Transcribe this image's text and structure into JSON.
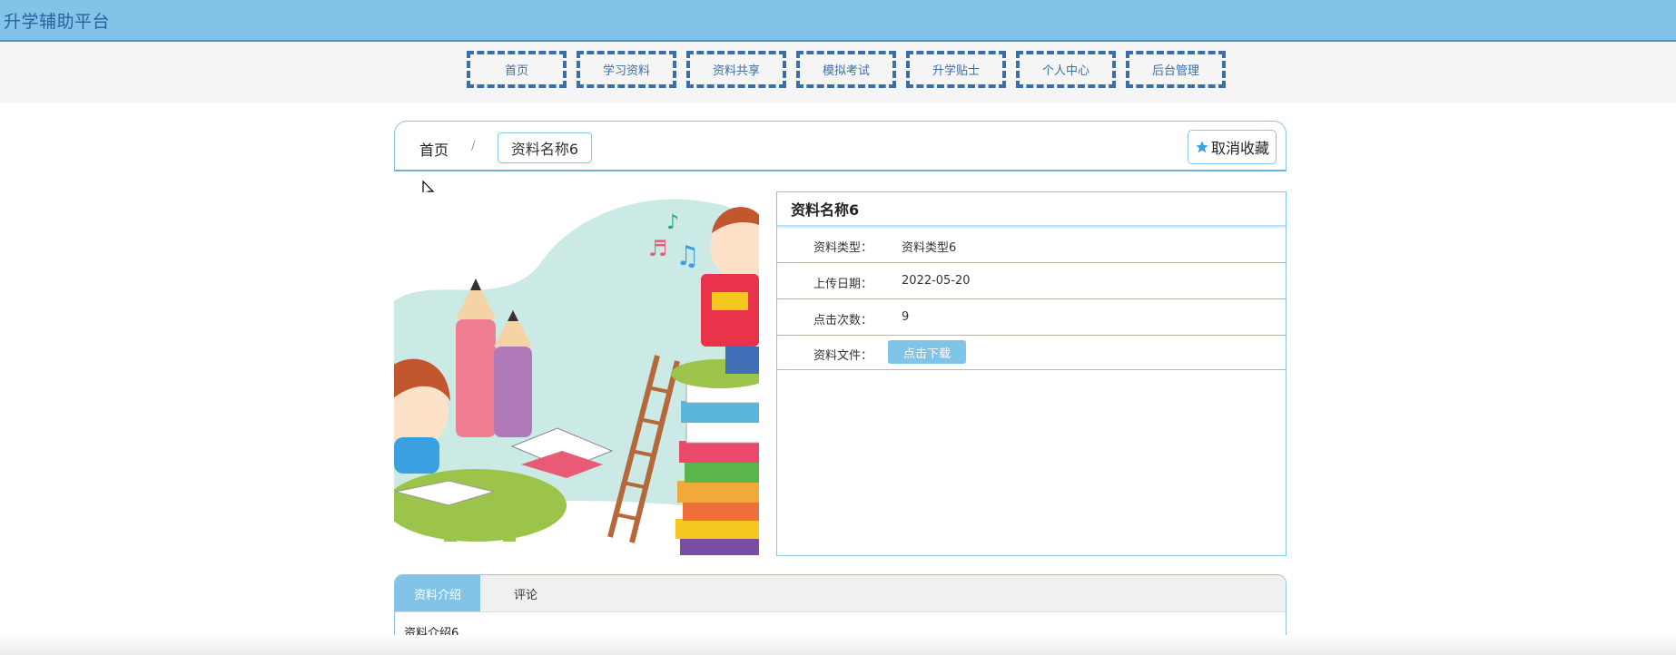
{
  "site": {
    "title": "升学辅助平台"
  },
  "nav": [
    {
      "label": "首页"
    },
    {
      "label": "学习资料"
    },
    {
      "label": "资料共享"
    },
    {
      "label": "模拟考试"
    },
    {
      "label": "升学贴士"
    },
    {
      "label": "个人中心"
    },
    {
      "label": "后台管理"
    }
  ],
  "breadcrumb": {
    "home": "首页",
    "separator": "/",
    "current": "资料名称6"
  },
  "favorite": {
    "label": "取消收藏",
    "icon": "star-icon",
    "color": "#3aa0e0"
  },
  "detail": {
    "title": "资料名称6",
    "rows": [
      {
        "key": "资料类型：",
        "value": "资料类型6"
      },
      {
        "key": "上传日期：",
        "value": "2022-05-20"
      },
      {
        "key": "点击次数：",
        "value": "9"
      },
      {
        "key": "资料文件：",
        "button": "点击下载"
      }
    ]
  },
  "tabs": [
    {
      "label": "资料介绍"
    },
    {
      "label": "评论"
    }
  ],
  "tab_content": "资料介绍6",
  "colors": {
    "accent": "#82c3e8",
    "border": "#8cc6e6",
    "nav_text": "#3b6ea8",
    "title_text": "#2b5f9e"
  }
}
